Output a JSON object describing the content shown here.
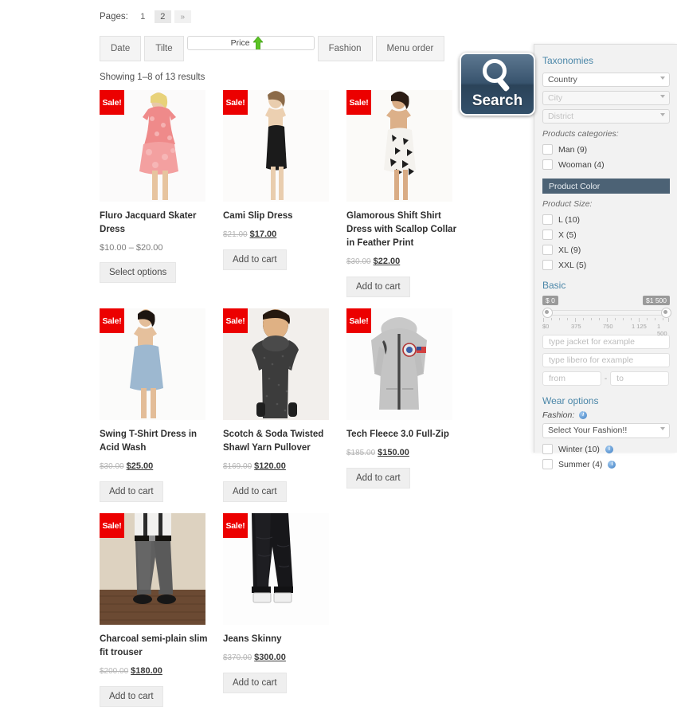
{
  "pagination": {
    "label": "Pages:",
    "pages": [
      "1",
      "2"
    ],
    "active_page": "2",
    "next_label": "»"
  },
  "sorting": {
    "buttons": [
      {
        "label": "Date",
        "selected": false,
        "arrow": false
      },
      {
        "label": "Tilte",
        "selected": false,
        "arrow": false
      },
      {
        "label": "Price",
        "selected": true,
        "arrow": true
      },
      {
        "label": "Fashion",
        "selected": false,
        "arrow": false
      },
      {
        "label": "Menu order",
        "selected": false,
        "arrow": false
      }
    ],
    "arrow_color": "#5cc425"
  },
  "results_text": "Showing 1–8 of 13 results",
  "sale_badge_text": "Sale!",
  "products": [
    {
      "title": "Fluro Jacquard Skater Dress",
      "price_range": "$10.00 – $20.00",
      "old_price": "",
      "new_price": "",
      "button": "Select options",
      "sale": true,
      "kind": "dress-pink"
    },
    {
      "title": "Cami Slip Dress",
      "price_range": "",
      "old_price": "$21.00",
      "new_price": "$17.00",
      "button": "Add to cart",
      "sale": true,
      "kind": "dress-black"
    },
    {
      "title": "Glamorous Shift Shirt Dress with Scallop Collar in Feather Print",
      "price_range": "",
      "old_price": "$30.00",
      "new_price": "$22.00",
      "button": "Add to cart",
      "sale": true,
      "kind": "dress-print"
    },
    {
      "title": "Swing T-Shirt Dress in Acid Wash",
      "price_range": "",
      "old_price": "$30.00",
      "new_price": "$25.00",
      "button": "Add to cart",
      "sale": true,
      "kind": "dress-blue"
    },
    {
      "title": "Scotch & Soda Twisted Shawl Yarn Pullover",
      "price_range": "",
      "old_price": "$169.00",
      "new_price": "$120.00",
      "button": "Add to cart",
      "sale": true,
      "kind": "sweater-grey"
    },
    {
      "title": "Tech Fleece 3.0 Full-Zip",
      "price_range": "",
      "old_price": "$185.00",
      "new_price": "$150.00",
      "button": "Add to cart",
      "sale": true,
      "kind": "hoodie-grey"
    },
    {
      "title": "Charcoal semi-plain slim fit trouser",
      "price_range": "",
      "old_price": "$200.00",
      "new_price": "$180.00",
      "button": "Add to cart",
      "sale": true,
      "kind": "trouser-grey"
    },
    {
      "title": "Jeans Skinny",
      "price_range": "",
      "old_price": "$370.00",
      "new_price": "$300.00",
      "button": "Add to cart",
      "sale": true,
      "kind": "jeans-black"
    }
  ],
  "search_widget": {
    "label": "Search",
    "icon": "magnifier-icon"
  },
  "sidebar": {
    "taxonomies_title": "Taxonomies",
    "selects": [
      {
        "value": "Country",
        "enabled": true
      },
      {
        "value": "City",
        "enabled": false
      },
      {
        "value": "District",
        "enabled": false
      }
    ],
    "products_categories_label": "Products categories:",
    "categories": [
      {
        "label": "Man (9)",
        "checked": false
      },
      {
        "label": "Wooman (4)",
        "checked": false
      }
    ],
    "product_color_header": "Product Color",
    "product_size_label": "Product Size:",
    "sizes": [
      {
        "label": "L (10)",
        "checked": false
      },
      {
        "label": "X (5)",
        "checked": false
      },
      {
        "label": "XL (9)",
        "checked": false
      },
      {
        "label": "XXL (5)",
        "checked": false
      }
    ],
    "basic_title": "Basic",
    "slider": {
      "min_tag": "$ 0",
      "max_tag": "$1 500",
      "ticks": [
        "$0",
        "375",
        "750",
        "1 125",
        "1 500"
      ],
      "min_value": 0,
      "max_value": 1500
    },
    "text_inputs": [
      {
        "placeholder": "type jacket for example"
      },
      {
        "placeholder": "type libero for example"
      }
    ],
    "range_inputs": {
      "from_placeholder": "from",
      "separator": "-",
      "to_placeholder": "to"
    },
    "wear_options_title": "Wear options",
    "fashion_label": "Fashion:",
    "fashion_select": "Select Your Fashion!!",
    "seasons": [
      {
        "label": "Winter (10)",
        "checked": false
      },
      {
        "label": "Summer (4)",
        "checked": false
      }
    ]
  },
  "colors": {
    "accent_blue": "#4a86a8",
    "sale_red": "#ec0000",
    "color_bar": "#4c6275",
    "arrow_green": "#5cc425"
  }
}
